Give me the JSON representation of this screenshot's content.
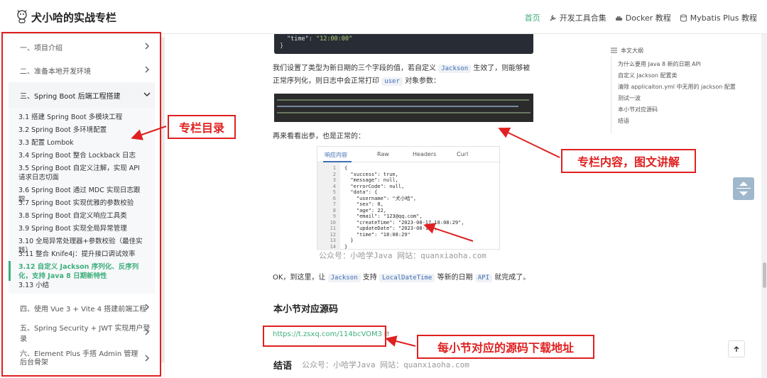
{
  "site": {
    "title": "犬小哈的实战专栏"
  },
  "nav": {
    "home": "首页",
    "tools": "开发工具合集",
    "docker": "Docker 教程",
    "mybatis": "Mybatis Plus 教程"
  },
  "sidebar": {
    "sections": [
      "一、项目介绍",
      "二、准备本地开发环境",
      "三、Spring Boot 后端工程搭建",
      "四、使用 Vue 3 + Vite 4 搭建前端工程",
      "五、Spring Security + JWT 实现用户登录",
      "六、Element Plus 手搭 Admin 管理后台骨架"
    ],
    "items": [
      "3.1 搭建 Spring Boot 多模块工程",
      "3.2 Spring Boot 多环境配置",
      "3.3 配置 Lombok",
      "3.4 Spring Boot 整合 Lockback 日志",
      "3.5 Spring Boot 自定义注解，实现 API 请求日志切面",
      "3.6 Spring Boot 通过 MDC 实现日志跟踪",
      "3.7 Spring Boot 实现优雅的参数校验",
      "3.8 Spring Boot 自定义响应工具类",
      "3.9 Spring Boot 实现全局异常管理",
      "3.10 全局异常处理器+参数校验（最佳实践）",
      "3.11 整合 Knife4j：提升接口调试效率",
      "3.12 自定义 Jackson 序列化、反序列化，支持 Java 8 日期新特性",
      "3.13 小结"
    ]
  },
  "annotations": {
    "catalog": "专栏目录",
    "content": "专栏内容，图文讲解",
    "source": "每小节对应的源码下载地址"
  },
  "code_top": {
    "key": "\"time\"",
    "sep": ": ",
    "value": "\"12:00:00\"",
    "close": "}"
  },
  "content": {
    "p1_a": "我们设置了类型为新日期的三个字段的值，若自定义",
    "p1_code1": "Jackson",
    "p1_b": "生效了，则能够被正常序列化，则日志中会正常打印",
    "p1_code2": "user",
    "p1_c": "对象参数：",
    "p2": "再来看看出参，也是正常的：",
    "p3_a": "OK，到这里，让",
    "p3_code1": "Jackson",
    "p3_b": "支持",
    "p3_code2": "LocalDateTime",
    "p3_c": "等新的日期",
    "p3_code3": "API",
    "p3_d": "就完成了。",
    "h_source": "本小节对应源码",
    "source_link": "https://t.zsxq.com/114bcVOM3",
    "h_summary": "结语",
    "watermark": "公众号：小哈学Java  网站：quanxiaoha.com"
  },
  "json_panel": {
    "tabs": [
      "响应内容",
      "Raw",
      "Headers",
      "Curl"
    ],
    "lines": [
      "{",
      "  \"success\": true,",
      "  \"message\": null,",
      "  \"errorCode\": null,",
      "  \"data\": {",
      "    \"username\": \"犬小哈\",",
      "    \"sex\": 0,",
      "    \"age\": 22,",
      "    \"email\": \"123@qq.com\",",
      "    \"createTime\": \"2023-08-17 18:08:29\",",
      "    \"updateDate\": \"2023-08-17\",",
      "    \"time\": \"18:08:29\"",
      "  }",
      "}"
    ],
    "line_numbers": [
      "1",
      "2",
      "3",
      "4",
      "5",
      "6",
      "7",
      "8",
      "9",
      "10",
      "11",
      "12",
      "13",
      "14"
    ]
  },
  "toc": {
    "title": "本文大纲",
    "items": [
      "为什么要用 Java 8 新的日期 API",
      "自定义 Jackson 配置类",
      "清除 applicaiton.yml 中无用的 jackson 配置",
      "测试一波",
      "本小节对应源码",
      "结语"
    ]
  },
  "colors": {
    "accent": "#3eaf7c",
    "annotation": "#e02020",
    "code_bg": "#282c34"
  }
}
